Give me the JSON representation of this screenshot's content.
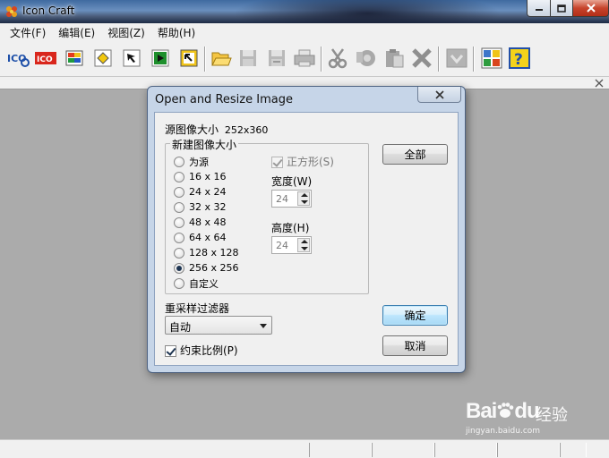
{
  "window": {
    "title": "Icon Craft"
  },
  "menu": [
    {
      "label": "文件(F)"
    },
    {
      "label": "编辑(E)"
    },
    {
      "label": "视图(Z)"
    },
    {
      "label": "帮助(H)"
    }
  ],
  "toolbar": {
    "ico_label": "ICO",
    "icons": [
      "ico-file-icon",
      "ico-format-icon",
      "palette-icon",
      "paint-bucket-icon",
      "pointer-icon",
      "play-icon",
      "export-icon",
      "open-folder-icon",
      "save-icon",
      "save-all-icon",
      "print-icon",
      "cut-icon",
      "copy-icon",
      "paste-icon",
      "delete-icon",
      "check-icon",
      "image-grid-icon",
      "help-icon"
    ]
  },
  "dialog": {
    "title": "Open and Resize Image",
    "source_size_label": "源图像大小",
    "source_size_value": "252x360",
    "new_size_group": "新建图像大小",
    "sizes": [
      {
        "label": "为源",
        "selected": false
      },
      {
        "label": "16 x 16",
        "selected": false
      },
      {
        "label": "24 x 24",
        "selected": false
      },
      {
        "label": "32 x 32",
        "selected": false
      },
      {
        "label": "48 x 48",
        "selected": false
      },
      {
        "label": "64 x 64",
        "selected": false
      },
      {
        "label": "128 x 128",
        "selected": false
      },
      {
        "label": "256 x 256",
        "selected": true
      },
      {
        "label": "自定义",
        "selected": false
      }
    ],
    "square_label": "正方形(S)",
    "square_checked": true,
    "width_label": "宽度(W)",
    "width_value": "24",
    "height_label": "高度(H)",
    "height_value": "24",
    "all_button": "全部",
    "filter_label": "重采样过滤器",
    "filter_value": "自动",
    "keep_ratio_label": "约束比例(P)",
    "keep_ratio_checked": true,
    "ok_button": "确定",
    "cancel_button": "取消"
  },
  "watermark": {
    "brand": "Bai",
    "brand2": "du",
    "jingyan": "经验",
    "url": "jingyan.baidu.com"
  },
  "colors": {
    "workspace": "#ababab",
    "dialog_frame": "#c6d5e8",
    "default_button": "#bee6fd"
  }
}
